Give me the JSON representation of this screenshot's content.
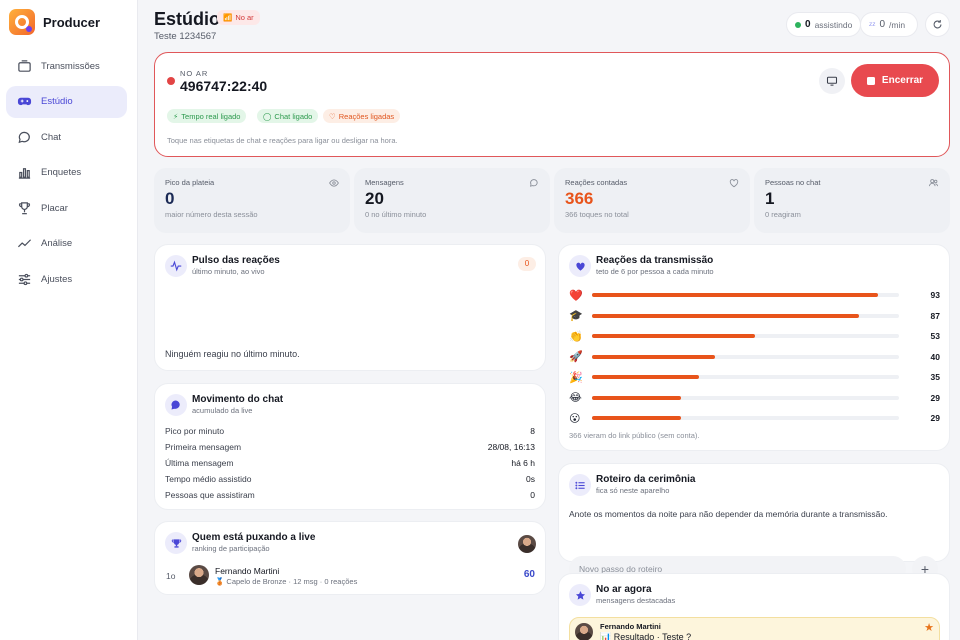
{
  "brand": {
    "name": "Producer"
  },
  "nav": [
    {
      "label": "Transmissões",
      "icon": "tv-icon"
    },
    {
      "label": "Estúdio",
      "icon": "gamepad-icon"
    },
    {
      "label": "Chat",
      "icon": "chat-icon"
    },
    {
      "label": "Enquetes",
      "icon": "bar-chart-icon"
    },
    {
      "label": "Placar",
      "icon": "trophy-icon"
    },
    {
      "label": "Análise",
      "icon": "trend-icon"
    },
    {
      "label": "Ajustes",
      "icon": "sliders-icon"
    }
  ],
  "header": {
    "title": "Estúdio",
    "badge": "No ar",
    "subtitle": "Teste 1234567",
    "watching_count": "0",
    "watching_label": "assistindo",
    "rate_value": "0",
    "rate_unit": "/min"
  },
  "live": {
    "label": "NO AR",
    "timer": "496747:22:40",
    "chips": [
      "Tempo real ligado",
      "Chat ligado",
      "Reações ligadas"
    ],
    "hint": "Toque nas etiquetas de chat e reações para ligar ou desligar na hora.",
    "end_label": "Encerrar"
  },
  "stats": [
    {
      "label": "Pico da plateia",
      "value": "0",
      "sub": "maior número desta sessão",
      "color": "#1b2a55"
    },
    {
      "label": "Mensagens",
      "value": "20",
      "sub": "0 no último minuto",
      "color": "#151821"
    },
    {
      "label": "Reações contadas",
      "value": "366",
      "sub": "366 toques no total",
      "color": "#e8541b"
    },
    {
      "label": "Pessoas no chat",
      "value": "1",
      "sub": "0 reagiram",
      "color": "#151821"
    }
  ],
  "pulse": {
    "title": "Pulso das reações",
    "sub": "último minuto, ao vivo",
    "count": "0",
    "empty": "Ninguém reagiu no último minuto."
  },
  "chat_moves": {
    "title": "Movimento do chat",
    "sub": "acumulado da live",
    "rows": [
      {
        "k": "Pico por minuto",
        "v": "8"
      },
      {
        "k": "Primeira mensagem",
        "v": "28/08, 16:13"
      },
      {
        "k": "Última mensagem",
        "v": "há 6 h"
      },
      {
        "k": "Tempo médio assistido",
        "v": "0s"
      },
      {
        "k": "Pessoas que assistiram",
        "v": "0"
      }
    ]
  },
  "leaders": {
    "title": "Quem está puxando a live",
    "sub": "ranking de participação",
    "rank": "1o",
    "name": "Fernando Martini",
    "detail": "🥉 Capelo de Bronze · 12 msg · 0 reações",
    "score": "60"
  },
  "reactions": {
    "title": "Reações da transmissão",
    "sub": "teto de 6 por pessoa a cada minuto",
    "items": [
      {
        "emoji": "❤️",
        "count": 93
      },
      {
        "emoji": "🎓",
        "count": 87
      },
      {
        "emoji": "👏",
        "count": 53
      },
      {
        "emoji": "🚀",
        "count": 40
      },
      {
        "emoji": "🎉",
        "count": 35
      },
      {
        "emoji": "😂",
        "count": 29
      },
      {
        "emoji": "😮",
        "count": 29
      }
    ],
    "max": 100,
    "note": "366 vieram do link público (sem conta)."
  },
  "script": {
    "title": "Roteiro da cerimônia",
    "sub": "fica só neste aparelho",
    "desc": "Anote os momentos da noite para não depender da memória durante a transmissão.",
    "placeholder": "Novo passo do roteiro"
  },
  "onair": {
    "title": "No ar agora",
    "sub": "mensagens destacadas",
    "author": "Fernando Martini",
    "message": "📊 Resultado · Teste ?"
  }
}
